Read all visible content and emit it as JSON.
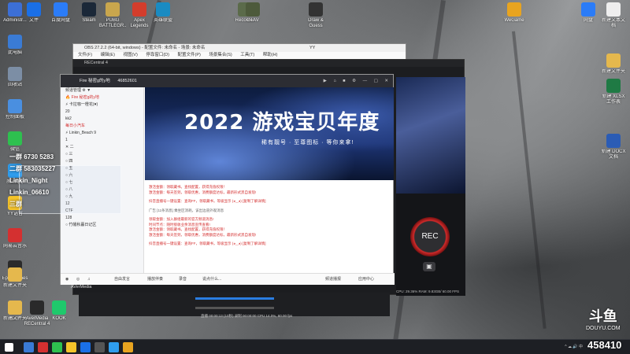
{
  "obs": {
    "title": "OBS 27.2.2 (64-bit, windows) - 配置文件: 未命名 - 场景: 未命名",
    "menu": [
      "文件(F)",
      "编辑(E)",
      "视图(V)",
      "停靠窗口(D)",
      "配置文件(P)",
      "场景集合(S)",
      "工具(T)",
      "帮助(H)"
    ],
    "right_label": "YY"
  },
  "recentral": {
    "title": "RECentral 4",
    "rec_label": "REC",
    "lock_icon": "lock-icon",
    "stats": "CPU: 29.36%  RAM: 9.83GB/ 60.00 FPS",
    "bottom_tabs": [
      "剪辑",
      "直播",
      "录制",
      "截图"
    ],
    "brand": "AVerMedia",
    "lower_status": "直播 00:00:13 (10秒) 录制 00:00:00 CPU 14.0%, 60.00 fps"
  },
  "chat": {
    "channel_title": "Fire 秘密g的y地",
    "channel_id": "46852601",
    "tab_icons": [
      "video-icon",
      "home-icon",
      "gift-icon",
      "settings-icon",
      "minimize-icon",
      "maximize-icon",
      "close-icon"
    ],
    "left_rows": [
      "频道管理   ⚙   ▼",
      "🔥 Fire 秘密g的y地",
      "   ⚡ 卡拉咖一橙花(♥)",
      "20",
      "kk2",
      "每日小汽车",
      "   ⚡ Linkin_Beach 9",
      "1",
      "   ✕ 二",
      "   ○ 三",
      "   ○ 四",
      "   ○ 五",
      "   ○ 六",
      "   ○ 七",
      "   ○ 八",
      "   ○ 九",
      "12",
      "CTF",
      "128",
      "   ○ 竹幡秋暮日记区"
    ],
    "banner_title": "2022 游戏宝贝年度",
    "banner_subtitle": "稀有靓号 · 至尊图标 · 等你来拿!",
    "messages": [
      {
        "cls": "red",
        "text": "激活金额：领取藏书。查找配置，获得充值权限！"
      },
      {
        "cls": "red",
        "text": "激活金额：每天签到，领取优惠，消费额度达标，最新形式黑自发现!"
      },
      {
        "cls": "gap",
        "text": ""
      },
      {
        "cls": "red",
        "text": "抖音直播号一键设置：查询FF，领取藏书，等级显示 (◕‿◕) [复制了解详情]"
      },
      {
        "cls": "gap",
        "text": ""
      },
      {
        "cls": "gray",
        "text": "广告 [11条消息] 乘坐区消耗，该出边道外观消息"
      },
      {
        "cls": "gap",
        "text": ""
      },
      {
        "cls": "red",
        "text": "领取金额：加入群组最新的官方频道消息!"
      },
      {
        "cls": "red",
        "text": "时间节点：随时接收业余消息宣传查看!"
      },
      {
        "cls": "red",
        "text": "激活金额：领取藏书。查找配置，获得充值权限！"
      },
      {
        "cls": "red",
        "text": "激活金额：每天签到，领取优惠，消费额度达标，最新形式黑自发现!"
      },
      {
        "cls": "gap",
        "text": ""
      },
      {
        "cls": "red",
        "text": "抖音直播号一键设置：查询FF，领取藏书，等级显示 (◕‿◕) [复制了解详情]"
      }
    ],
    "footer": {
      "mic_label": "自由发言",
      "play_label": "播放伴奏",
      "record_label": "录音",
      "input_placeholder": "说点什么...",
      "game_label": "频道播报",
      "app_label": "应用中心"
    }
  },
  "overlay": {
    "lines": [
      "一群 6730 5283",
      "二群 583035227",
      "Linkin_Night",
      "Linkin_06610",
      "三群"
    ]
  },
  "watermark": {
    "logo_text": "斗鱼",
    "url": "DOUYU.COM",
    "room_id": "458410"
  },
  "desktop_icons_left": [
    {
      "label": "Administr...",
      "color": "#3c6fd6"
    },
    {
      "label": "此电脑",
      "color": "#3a7bd5"
    },
    {
      "label": "回收站",
      "color": "#7c8ea5"
    },
    {
      "label": "控制面板",
      "color": "#4a8fe0"
    },
    {
      "label": "微信",
      "color": "#2ec04f"
    },
    {
      "label": "腾讯QQ",
      "color": "#2f9ded"
    },
    {
      "label": "YY语音",
      "color": "#f6c42a"
    },
    {
      "label": "网易云音乐",
      "color": "#d43030"
    },
    {
      "label": "Epic Games",
      "color": "#2b2b2b"
    },
    {
      "label": "抖音",
      "color": "#111"
    },
    {
      "label": "新建文件夹",
      "color": "#e5b84d"
    },
    {
      "label": "工作",
      "color": "#e5b84d"
    }
  ],
  "desktop_icons_top": [
    {
      "label": "文件",
      "color": "#1a6fe6"
    },
    {
      "label": "百度网盘",
      "color": "#2b7cf7"
    },
    {
      "label": "Steam",
      "color": "#1b2838"
    },
    {
      "label": "PUBG BATTLEGR...",
      "color": "#c9a64d"
    },
    {
      "label": "Apex Legends",
      "color": "#d33d2c"
    },
    {
      "label": "英雄联盟",
      "color": "#1a8bc2"
    },
    {
      "label": "Recorder",
      "color": "#5b6b4a"
    },
    {
      "label": "GTAV",
      "color": "#4d5a3b"
    },
    {
      "label": "Draw & Guess",
      "color": "#333"
    }
  ],
  "desktop_icons_right": [
    {
      "label": "网盘",
      "color": "#2b7cf7"
    },
    {
      "label": "新建文本文档",
      "color": "#eee"
    },
    {
      "label": "新建文件夹",
      "color": "#e5b84d"
    },
    {
      "label": "新建 DOCX 文档",
      "color": "#2b5cb5"
    },
    {
      "label": "新建 XLSX 工作表",
      "color": "#1f7a44"
    },
    {
      "label": "WeGame",
      "color": "#e8a420"
    }
  ],
  "taskbar": {
    "tray_text": "^  ☁  🔊  中  ",
    "icons": [
      "#3a7bd5",
      "#d43030",
      "#2ec04f",
      "#f6c42a",
      "#1a6fe6",
      "#555",
      "#2f9ded",
      "#e8a420"
    ]
  }
}
